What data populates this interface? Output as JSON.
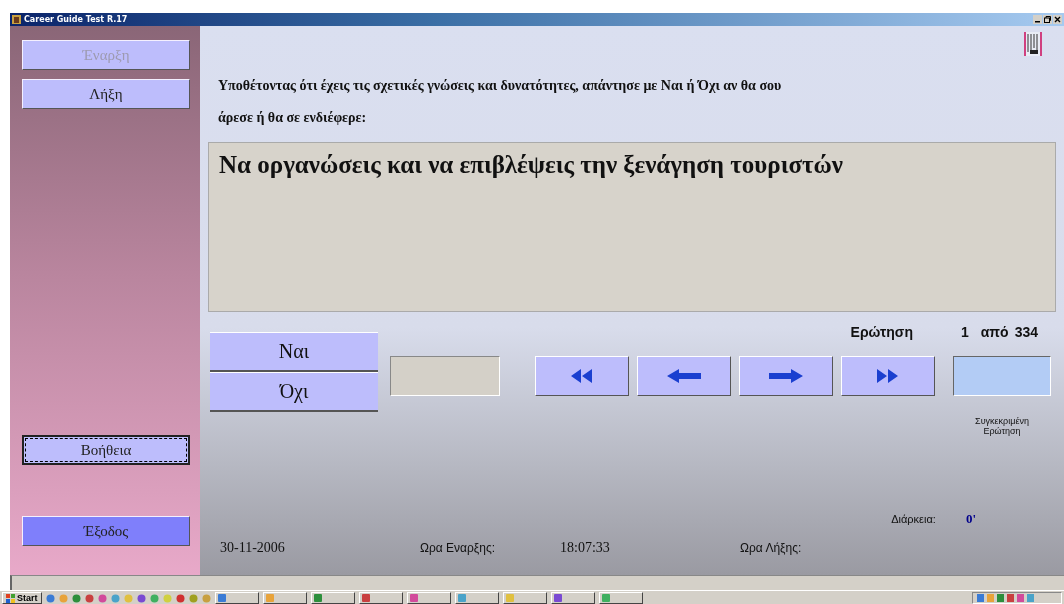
{
  "window": {
    "title": "Career Guide Test R.17"
  },
  "sidebar": {
    "top_buttons": [
      {
        "label": "Έναρξη",
        "disabled": true
      },
      {
        "label": "Λήξη",
        "disabled": false
      }
    ],
    "bottom_buttons": [
      {
        "label": "Βοήθεια",
        "focused": true,
        "highlighted": false
      },
      {
        "label": "Έξοδος",
        "focused": false,
        "highlighted": true
      }
    ]
  },
  "instruction": "Υποθέτοντας ότι έχεις τις σχετικές γνώσεις και δυνατότητες, απάντησε με Ναι ή Όχι αν θα σου άρεσε ή θα σε ενδιέφερε:",
  "question": "Να οργανώσεις και να επιβλέψεις την ξενάγηση τουριστών",
  "counter": {
    "label": "Ερώτηση",
    "number": "1",
    "of": "από",
    "total": "334"
  },
  "answers": [
    "Ναι",
    "Όχι"
  ],
  "navigation": [
    {
      "kind": "first"
    },
    {
      "kind": "previous"
    },
    {
      "kind": "next"
    },
    {
      "kind": "last"
    }
  ],
  "goto": {
    "caption": "Συγκεκριμένη Ερώτηση"
  },
  "duration": {
    "label": "Διάρκεια:",
    "value": "0'"
  },
  "footer": {
    "date": "30-11-2006",
    "start_label": "Ωρα Εναρξης:",
    "start_time": "18:07:33",
    "end_label": "Ωρα Λήξης:"
  },
  "taskbar": {
    "start": "Start"
  }
}
